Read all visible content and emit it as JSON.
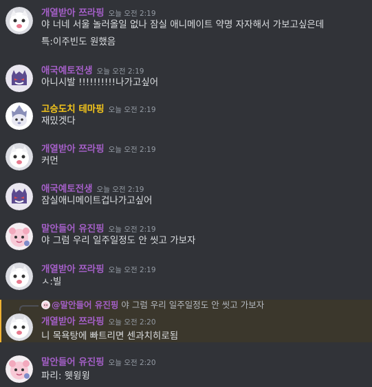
{
  "colors": {
    "background": "#313338",
    "mention_background": "#3b372c",
    "mention_bar": "#f0b232",
    "text": "#dbdee1",
    "timestamp": "#949ba4"
  },
  "users": {
    "u1": {
      "name": "개열받아 쯔라핑",
      "color": "#a45fc7",
      "avatar_icon": "white-cat-avatar-icon"
    },
    "u2": {
      "name": "애국예토전생",
      "color": "#a45fc7",
      "avatar_icon": "gengar-avatar-icon"
    },
    "u3": {
      "name": "고승도치 테마핑",
      "color": "#f5c61b",
      "avatar_icon": "hedgehog-avatar-icon"
    },
    "u4": {
      "name": "말안들어 유진핑",
      "color": "#a45fc7",
      "avatar_icon": "pink-character-avatar-icon"
    }
  },
  "messages": [
    {
      "user": "개열받아 쯔라핑",
      "time": "오늘 오전 2:19",
      "lines": [
        "야 너네 서울 놀러올일 없나 잠실 애니메이트 약명 자자해서 가보고싶은데",
        "특:이주빈도 원했음"
      ]
    },
    {
      "user": "애국예토전생",
      "time": "오늘 오전 2:19",
      "lines": [
        "아니시발 !!!!!!!!!!나가고싶어"
      ]
    },
    {
      "user": "고승도치 테마핑",
      "time": "오늘 오전 2:19",
      "lines": [
        "재밌겟다"
      ]
    },
    {
      "user": "개열받아 쯔라핑",
      "time": "오늘 오전 2:19",
      "lines": [
        "커먼"
      ]
    },
    {
      "user": "애국예토전생",
      "time": "오늘 오전 2:19",
      "lines": [
        "잠실애니메이트겁나가고싶어"
      ]
    },
    {
      "user": "말안들어 유진핑",
      "time": "오늘 오전 2:19",
      "lines": [
        "야 그럼 우리 일주일정도 안 씻고 가보자"
      ]
    },
    {
      "user": "개열받아 쯔라핑",
      "time": "오늘 오전 2:19",
      "lines": [
        "ㅅ:빌"
      ]
    },
    {
      "user": "개열받아 쯔라핑",
      "time": "오늘 오전 2:20",
      "reply": {
        "name": "@말안들어 유진핑",
        "text": "야 그럼 우리 일주일정도 안 씻고 가보자"
      },
      "lines": [
        "니 목욕탕에 빠트리면 센과치히로됨"
      ]
    },
    {
      "user": "말안들어 유진핑",
      "time": "오늘 오전 2:20",
      "lines": [
        "파리: 웻윙윙"
      ]
    }
  ]
}
